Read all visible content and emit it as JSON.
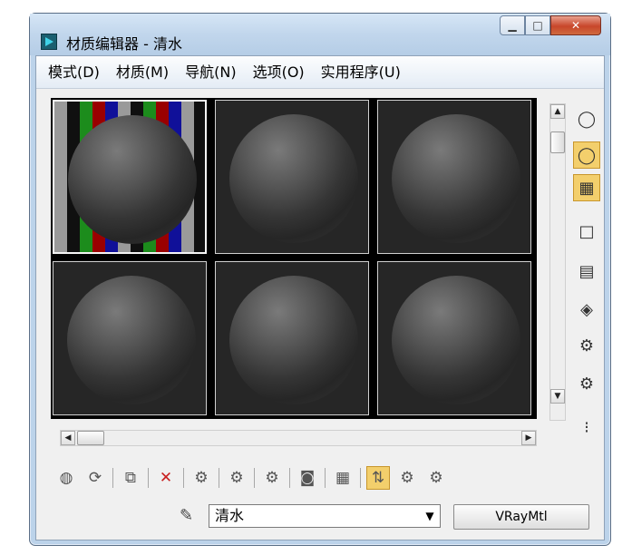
{
  "window": {
    "title": "材质编辑器 - 清水",
    "minimize_icon": "minimize-icon",
    "maximize_icon": "maximize-icon",
    "close_icon": "close-icon"
  },
  "menu": [
    "模式(D)",
    "材质(M)",
    "导航(N)",
    "选项(O)",
    "实用程序(U)"
  ],
  "slots": [
    {
      "name": "slot-1",
      "active": true,
      "background": "checker"
    },
    {
      "name": "slot-2"
    },
    {
      "name": "slot-3"
    },
    {
      "name": "slot-4"
    },
    {
      "name": "slot-5"
    },
    {
      "name": "slot-6"
    }
  ],
  "material": {
    "name": "清水",
    "type": "VRayMtl"
  },
  "side_tools": [
    "sample-type-icon",
    "backlight-icon",
    "background-icon",
    "uv-tiling-icon",
    "video-color-check-icon",
    "make-preview-icon",
    "options-icon",
    "select-by-material-icon",
    "material-navigator-icon",
    "material-tree-icon"
  ],
  "bottom_tools": [
    "get-material-icon",
    "put-to-scene-icon",
    "assign-to-selection-icon",
    "reset-material-icon",
    "make-copy-icon",
    "make-unique-icon",
    "put-to-library-icon",
    "material-id-channel-icon",
    "show-map-in-viewport-icon",
    "show-end-result-icon",
    "go-to-parent-icon",
    "go-forward-sibling-icon"
  ]
}
